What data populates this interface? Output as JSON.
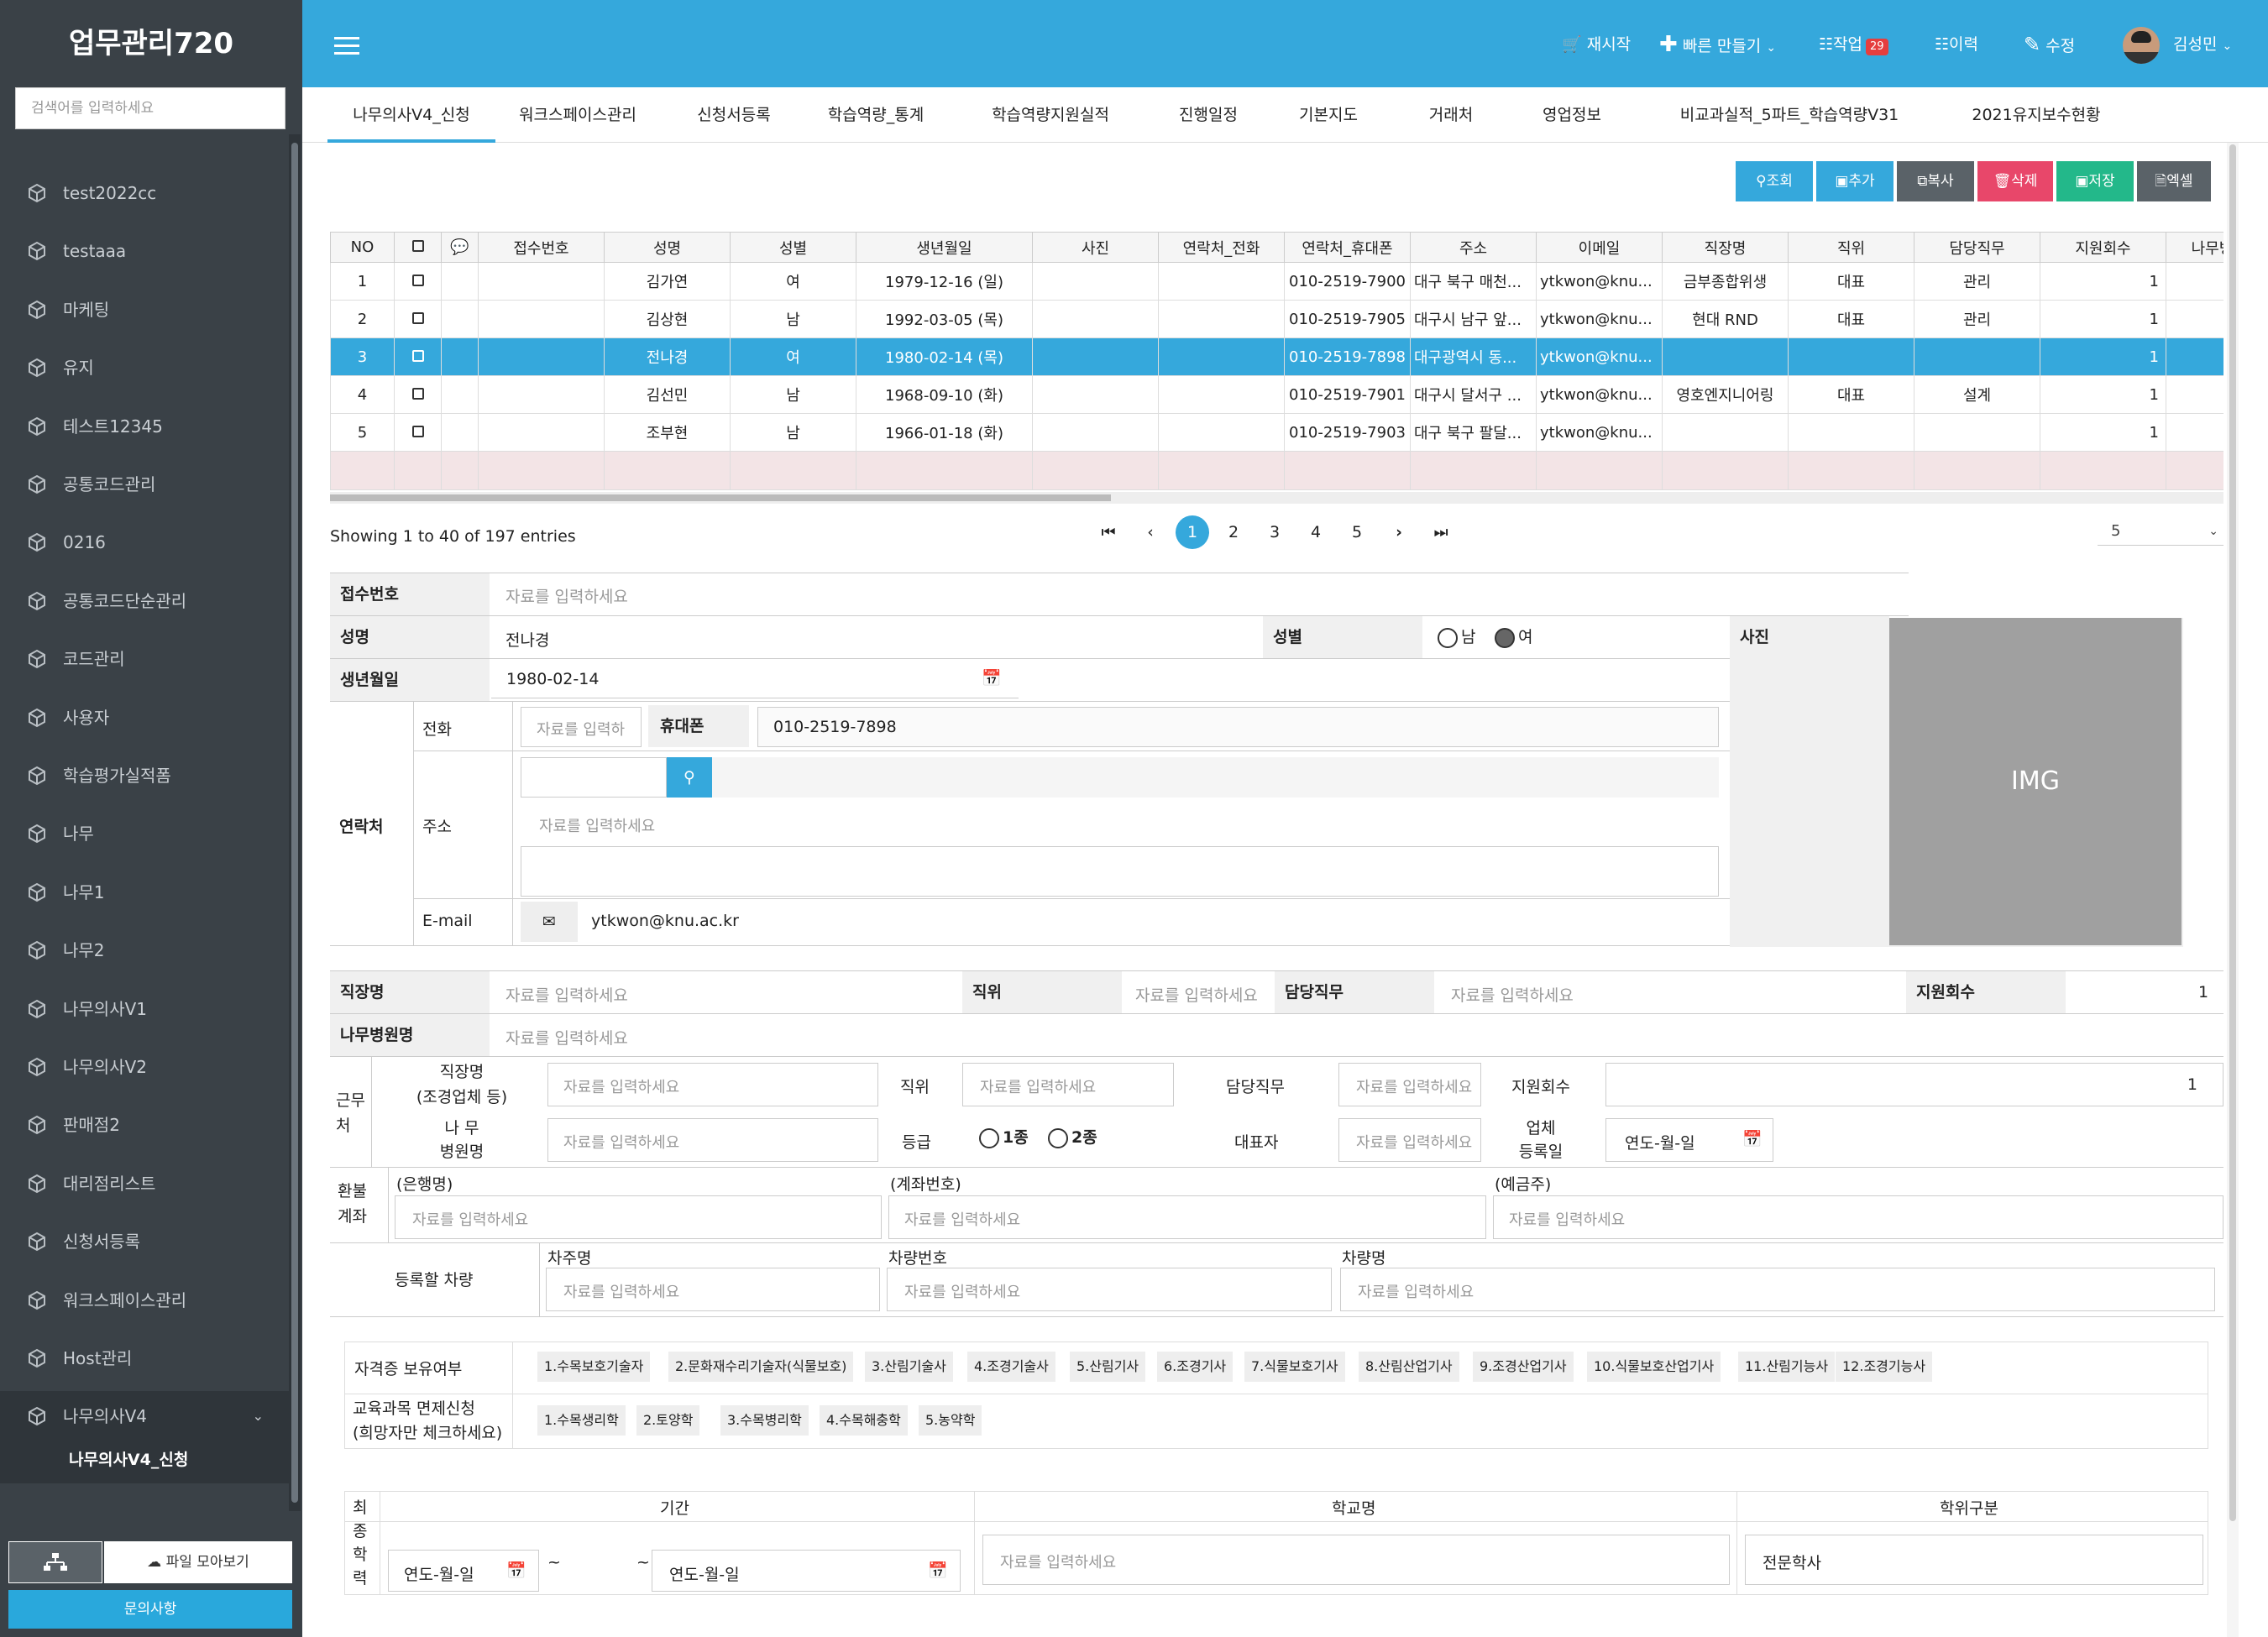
{
  "app": {
    "title": "업무관리720",
    "search_placeholder": "검색어를 입력하세요"
  },
  "sidebar": {
    "items": [
      {
        "label": "test2022cc"
      },
      {
        "label": "testaaa"
      },
      {
        "label": "마케팅"
      },
      {
        "label": "유지"
      },
      {
        "label": "테스트12345"
      },
      {
        "label": "공통코드관리"
      },
      {
        "label": "0216"
      },
      {
        "label": "공통코드단순관리"
      },
      {
        "label": "코드관리"
      },
      {
        "label": "사용자"
      },
      {
        "label": "학습평가실적폼"
      },
      {
        "label": "나무"
      },
      {
        "label": "나무1"
      },
      {
        "label": "나무2"
      },
      {
        "label": "나무의사V1"
      },
      {
        "label": "나무의사V2"
      },
      {
        "label": "판매점2"
      },
      {
        "label": "대리점리스트"
      },
      {
        "label": "신청서등록"
      },
      {
        "label": "워크스페이스관리"
      },
      {
        "label": "Host관리"
      },
      {
        "label": "나무의사V4"
      }
    ],
    "active_sub": "나무의사V4_신청",
    "file_button": "파일 모아보기",
    "qna_button": "문의사항"
  },
  "topbar": {
    "restart": "재시작",
    "quick_create": "빠른 만들기",
    "jobs": "작업",
    "jobs_count": "29",
    "history": "이력",
    "edit": "수정",
    "user": "김성민"
  },
  "tabs": [
    "나무의사V4_신청",
    "워크스페이스관리",
    "신청서등록",
    "학습역량_통계",
    "학습역량지원실적",
    "진행일정",
    "기본지도",
    "거래처",
    "영업정보",
    "비교과실적_5파트_학습역량V31",
    "2021유지보수현황"
  ],
  "toolbar": {
    "search": "조회",
    "add": "추가",
    "copy": "복사",
    "delete": "삭제",
    "save": "저장",
    "excel": "엑셀"
  },
  "grid": {
    "columns": [
      "NO",
      "",
      "",
      "접수번호",
      "성명",
      "성별",
      "생년월일",
      "사진",
      "연락처_전화",
      "연락처_휴대폰",
      "주소",
      "이메일",
      "직장명",
      "직위",
      "담당직무",
      "지원회수",
      "나무병"
    ],
    "rows": [
      [
        "1",
        "",
        "",
        "",
        "김가연",
        "여",
        "1979-12-16 (일)",
        "",
        "",
        "010-2519-7900",
        "대구 북구 매천...",
        "ytkwon@knu...",
        "금부종합위생",
        "대표",
        "관리",
        "1",
        ""
      ],
      [
        "2",
        "",
        "",
        "",
        "김상현",
        "남",
        "1992-03-05 (목)",
        "",
        "",
        "010-2519-7905",
        "대구시 남구 앞...",
        "ytkwon@knu...",
        "현대 RND",
        "대표",
        "관리",
        "1",
        ""
      ],
      [
        "3",
        "",
        "",
        "",
        "전나경",
        "여",
        "1980-02-14 (목)",
        "",
        "",
        "010-2519-7898",
        "대구광역시 동...",
        "ytkwon@knu...",
        "",
        "",
        "",
        "1",
        ""
      ],
      [
        "4",
        "",
        "",
        "",
        "김선민",
        "남",
        "1968-09-10 (화)",
        "",
        "",
        "010-2519-7901",
        "대구시 달서구 ...",
        "ytkwon@knu...",
        "영호엔지니어링",
        "대표",
        "설계",
        "1",
        ""
      ],
      [
        "5",
        "",
        "",
        "",
        "조부현",
        "남",
        "1966-01-18 (화)",
        "",
        "",
        "010-2519-7903",
        "대구 북구 팔달...",
        "ytkwon@knu...",
        "",
        "",
        "",
        "1",
        ""
      ]
    ],
    "selected_row": 3
  },
  "paging": {
    "showing": "Showing 1 to 40 of 197 entries",
    "pages": [
      "1",
      "2",
      "3",
      "4",
      "5"
    ],
    "current": "1",
    "page_size": "5"
  },
  "form": {
    "placeholder": "자료를 입력하세요",
    "placeholder_short": "자료를 입력하",
    "receipt_no_label": "접수번호",
    "name_label": "성명",
    "name_value": "전나경",
    "gender_label": "성별",
    "gender_male": "남",
    "gender_female": "여",
    "gender_value": "여",
    "birth_label": "생년월일",
    "birth_value": "1980-02-14",
    "photo_label": "사진",
    "photo_img": "IMG",
    "contact_label": "연락처",
    "phone_label": "전화",
    "mobile_label": "휴대폰",
    "mobile_value": "010-2519-7898",
    "address_label": "주소",
    "email_label": "E-mail",
    "email_value": "ytkwon@knu.ac.kr",
    "work_label": "직장명",
    "position_label": "직위",
    "duty_label": "담당직무",
    "count_label": "지원회수",
    "count_value": "1",
    "hospital_label": "나무병원명",
    "work_section_label": "근무처",
    "work_name_label": "직장명\n(조경업체 등)",
    "hospital_name_label": "나 무\n병원명",
    "grade_label": "등급",
    "grade1": "1종",
    "grade2": "2종",
    "ceo_label": "대표자",
    "reg_date_label": "업체\n등록일",
    "date_placeholder": "연도-월-일",
    "refund_label": "환불\n계좌",
    "bank_label": "(은행명)",
    "account_label": "(계좌번호)",
    "holder_label": "(예금주)",
    "vehicle_label": "등록할 차량",
    "owner_label": "차주명",
    "car_no_label": "차량번호",
    "car_name_label": "차량명",
    "cert_label": "자격증 보유여부",
    "certs": [
      "1.수목보호기술자",
      "2.문화재수리기술자(식물보호)",
      "3.산림기술사",
      "4.조경기술사",
      "5.산림기사",
      "6.조경기사",
      "7.식물보호기사",
      "8.산림산업기사",
      "9.조경산업기사",
      "10.식물보호산업기사",
      "11.산림기능사",
      "12.조경기능사"
    ],
    "edu_label": "교육과목 면제신청\n(희망자만 체크하세요)",
    "edus": [
      "1.수목생리학",
      "2.토양학",
      "3.수목병리학",
      "4.수목해충학",
      "5.농약학"
    ],
    "final_edu_label": "최종학력",
    "period_label": "기간",
    "school_label": "학교명",
    "degree_label": "학위구분",
    "degree_value": "전문학사",
    "tilde": "~"
  }
}
